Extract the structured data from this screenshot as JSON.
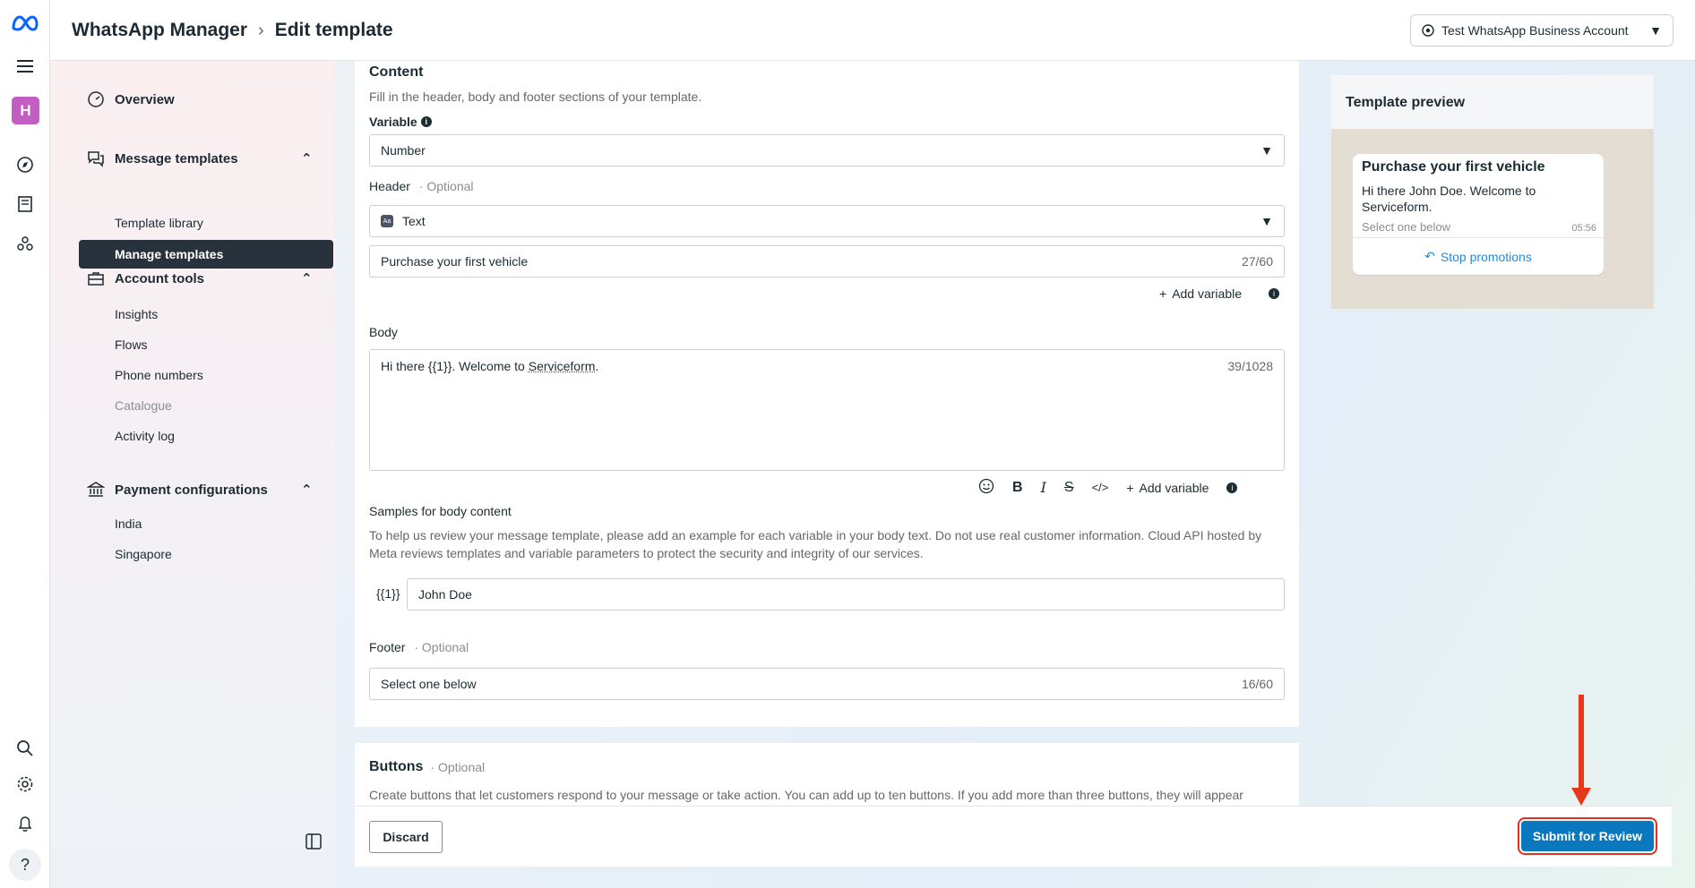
{
  "header": {
    "app_name": "WhatsApp Manager",
    "page_title": "Edit template",
    "account_button": "Test WhatsApp Business Account"
  },
  "rail": {
    "avatar_letter": "H"
  },
  "sidebar": {
    "overview": "Overview",
    "message_templates": {
      "label": "Message templates",
      "items": [
        "Manage templates",
        "Template library"
      ]
    },
    "account_tools": {
      "label": "Account tools",
      "items": [
        "Insights",
        "Flows",
        "Phone numbers",
        "Catalogue",
        "Activity log"
      ]
    },
    "payment_configurations": {
      "label": "Payment configurations",
      "items": [
        "India",
        "Singapore"
      ]
    }
  },
  "content": {
    "title": "Content",
    "subtitle": "Fill in the header, body and footer sections of your template.",
    "variable_label": "Variable",
    "variable_value": "Number",
    "header_label": "Header",
    "optional": "Optional",
    "header_type": "Text",
    "header_type_icon": "Aa",
    "header_text": "Purchase your first vehicle",
    "header_count": "27/60",
    "add_variable": "Add variable",
    "body_label": "Body",
    "body_text_pre": "Hi there {{1}}. Welcome to ",
    "body_text_link": "Serviceform",
    "body_text_post": ".",
    "body_count": "39/1028",
    "samples_label": "Samples for body content",
    "samples_help": "To help us review your message template, please add an example for each variable in your body text. Do not use real customer information. Cloud API hosted by Meta reviews templates and variable parameters to protect the security and integrity of our services.",
    "sample_var": "{{1}}",
    "sample_value": "John Doe",
    "footer_label": "Footer",
    "footer_text": "Select one below",
    "footer_count": "16/60"
  },
  "buttons_section": {
    "title": "Buttons",
    "optional": "Optional",
    "description": "Create buttons that let customers respond to your message or take action. You can add up to ten buttons. If you add more than three buttons, they will appear"
  },
  "actions": {
    "discard": "Discard",
    "submit": "Submit for Review"
  },
  "preview": {
    "title": "Template preview",
    "msg_title": "Purchase your first vehicle",
    "msg_body": "Hi there John Doe. Welcome to Serviceform.",
    "msg_footer": "Select one below",
    "msg_time": "05:56",
    "msg_button": "Stop promotions"
  },
  "colors": {
    "primary": "#0a78be",
    "highlight": "#e0321e",
    "nav_active": "#27323c"
  }
}
